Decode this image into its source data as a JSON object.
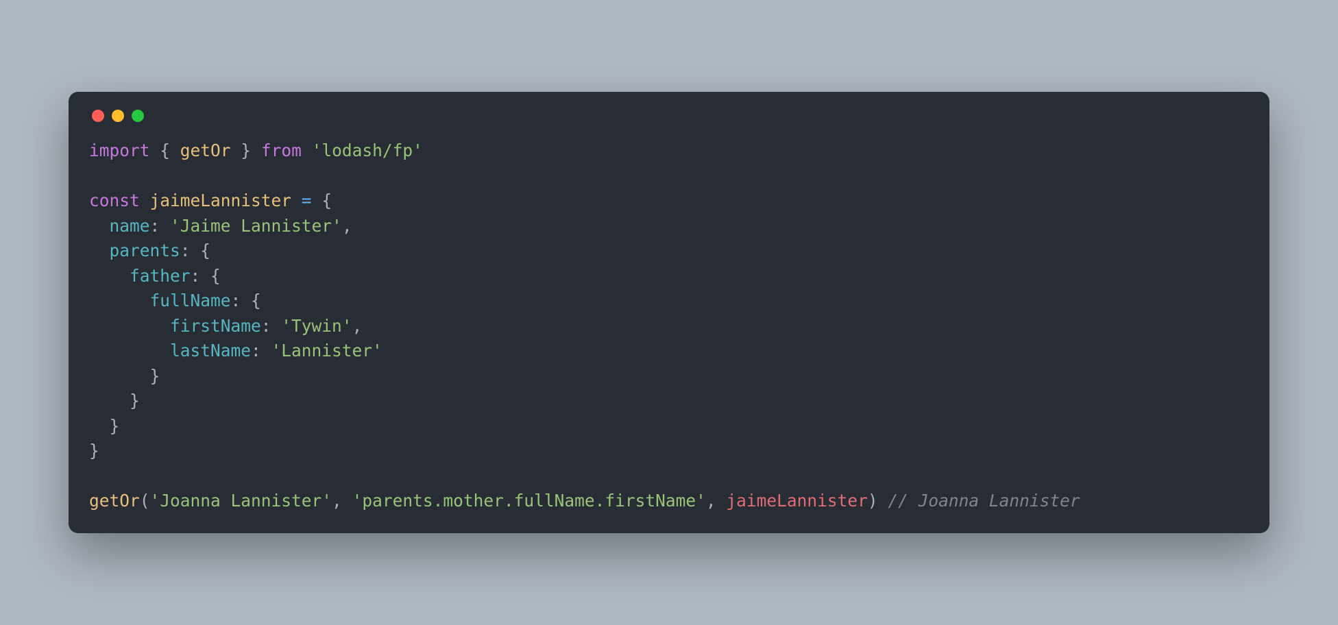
{
  "colors": {
    "background": "#aeb8c2",
    "window": "#282c34",
    "red": "#ff5f56",
    "yellow": "#ffbd2e",
    "green": "#27c93f"
  },
  "code": {
    "l1_import": "import",
    "l1_brace_open": " { ",
    "l1_getOr": "getOr",
    "l1_brace_close": " } ",
    "l1_from": "from",
    "l1_module": " 'lodash/fp'",
    "blank": "",
    "l3_const": "const",
    "l3_space": " ",
    "l3_var": "jaimeLannister",
    "l3_eq": " = ",
    "l3_open": "{",
    "l4_indent": "  ",
    "l4_key": "name",
    "l4_colon": ": ",
    "l4_val": "'Jaime Lannister'",
    "l4_comma": ",",
    "l5_indent": "  ",
    "l5_key": "parents",
    "l5_colon": ": ",
    "l5_open": "{",
    "l6_indent": "    ",
    "l6_key": "father",
    "l6_colon": ": ",
    "l6_open": "{",
    "l7_indent": "      ",
    "l7_key": "fullName",
    "l7_colon": ": ",
    "l7_open": "{",
    "l8_indent": "        ",
    "l8_key": "firstName",
    "l8_colon": ": ",
    "l8_val": "'Tywin'",
    "l8_comma": ",",
    "l9_indent": "        ",
    "l9_key": "lastName",
    "l9_colon": ": ",
    "l9_val": "'Lannister'",
    "l10_indent": "      ",
    "l10_close": "}",
    "l11_indent": "    ",
    "l11_close": "}",
    "l12_indent": "  ",
    "l12_close": "}",
    "l13_close": "}",
    "l15_fn": "getOr",
    "l15_p_open": "(",
    "l15_arg1": "'Joanna Lannister'",
    "l15_sep1": ", ",
    "l15_arg2": "'parents.mother.fullName.firstName'",
    "l15_sep2": ", ",
    "l15_arg3": "jaimeLannister",
    "l15_p_close": ")",
    "l15_space": " ",
    "l15_comment": "// Joanna Lannister"
  }
}
